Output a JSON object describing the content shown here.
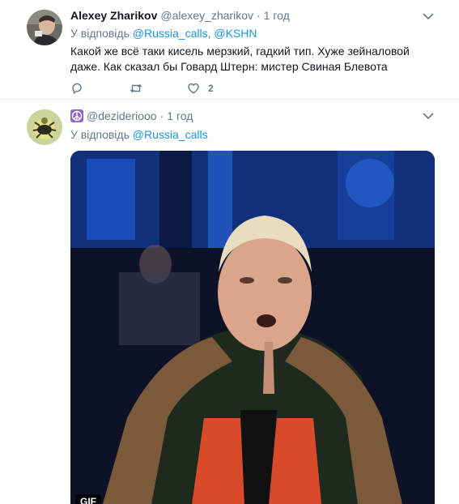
{
  "tweets": [
    {
      "name": "Alexey Zharikov",
      "handle": "@alexey_zharikov",
      "separator": "·",
      "time": "1 год",
      "reply_prefix": "У відповідь",
      "mentions": [
        "@Russia_calls",
        "@KSHN"
      ],
      "mention_separator": ", ",
      "text": "Какой же всё таки кисель мерзкий, гадкий тип. Хуже зейналовой даже. Как сказал бы Говард Штерн: мистер Свиная Блевота",
      "like_count": "2",
      "icons": {
        "reply": "reply-icon",
        "retweet": "retweet-icon",
        "like": "heart-icon",
        "menu": "chevron-down-icon"
      }
    },
    {
      "name": "",
      "handle": "@dezideriooo",
      "separator": "·",
      "time": "1 год",
      "reply_prefix": "У відповідь",
      "mentions": [
        "@Russia_calls"
      ],
      "media_type": "GIF",
      "icons": {
        "name_emoji": "peace-symbol-icon",
        "menu": "chevron-down-icon"
      }
    }
  ],
  "colors": {
    "link": "#1b95e0",
    "muted": "#657786",
    "text": "#14171a",
    "divider": "#e6ecf0"
  }
}
